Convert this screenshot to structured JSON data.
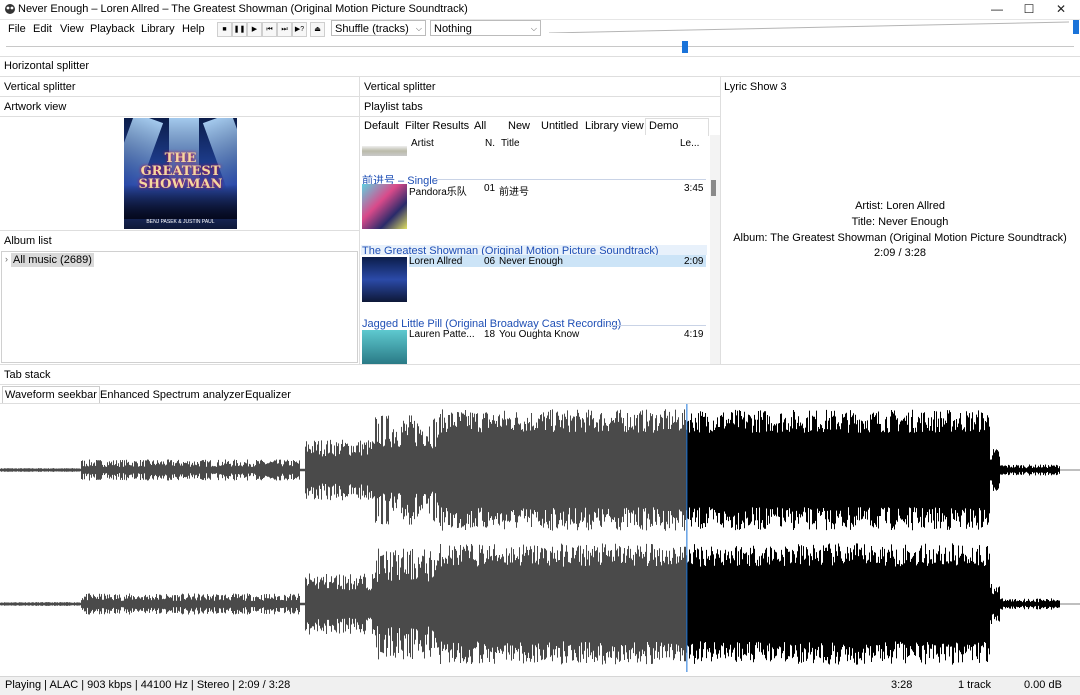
{
  "window": {
    "title": "Never Enough – Loren Allred – The Greatest Showman (Original Motion Picture Soundtrack)",
    "minimize": "—",
    "maximize": "☐",
    "close": "✕"
  },
  "menu": [
    "File",
    "Edit",
    "View",
    "Playback",
    "Library",
    "Help"
  ],
  "toolbar": {
    "stop": "■",
    "pause": "❚❚",
    "play": "▶",
    "prev": "⏮",
    "next": "⏭",
    "random": "▶?",
    "open": "⏏",
    "order_value": "Shuffle (tracks)",
    "stop_after_value": "Nothing"
  },
  "seek": {
    "position_fraction": 0.636,
    "volume_fraction": 1.0
  },
  "panels": {
    "horizontal_splitter": "Horizontal splitter",
    "vertical_splitter_left": "Vertical splitter",
    "vertical_splitter_mid": "Vertical splitter",
    "artwork_view": "Artwork view",
    "playlist_tabs": "Playlist tabs",
    "lyric_show": "Lyric Show 3",
    "album_list": "Album list",
    "tab_stack": "Tab stack"
  },
  "album_art": {
    "title_line1": "THE GREATEST",
    "title_line2": "SHOWMAN",
    "credit": "BENJ PASEK & JUSTIN PAUL"
  },
  "album_list": {
    "root": "All music (2689)"
  },
  "playlist": {
    "tabs": [
      "Default",
      "Filter Results",
      "All",
      "New",
      "Untitled",
      "Library view",
      "Demo"
    ],
    "active_tab": "Demo",
    "columns": {
      "artist": "Artist",
      "num": "N.",
      "title": "Title",
      "length": "Le..."
    },
    "groups": [
      {
        "header": "前进号 – Single",
        "artist": "Pandora乐队",
        "num": "01",
        "title": "前进号",
        "length": "3:45"
      },
      {
        "header": "The Greatest Showman (Original Motion Picture Soundtrack)",
        "artist": "Loren Allred",
        "num": "06",
        "title": "Never Enough",
        "length": "2:09"
      },
      {
        "header": "Jagged Little Pill (Original Broadway Cast Recording)",
        "artist": "Lauren Patte...",
        "num": "18",
        "title": "You Oughta Know",
        "length": "4:19"
      }
    ]
  },
  "lyrics": {
    "artist": "Artist: Loren Allred",
    "title": "Title: Never Enough",
    "album": "Album: The Greatest Showman (Original Motion Picture Soundtrack)",
    "time": "2:09 / 3:28"
  },
  "tab_stack": {
    "tabs": [
      "Waveform seekbar",
      "Enhanced Spectrum analyzer",
      "Equalizer"
    ]
  },
  "status": {
    "left": "Playing | ALAC | 903 kbps | 44100 Hz | Stereo | 2:09 / 3:28",
    "length": "3:28",
    "track": "1 track",
    "gain": "0.00 dB"
  },
  "colors": {
    "accent": "#1a73d9",
    "link": "#1f4fb5",
    "played_wave": "#4a4a4a",
    "unplayed_wave": "#000000"
  }
}
